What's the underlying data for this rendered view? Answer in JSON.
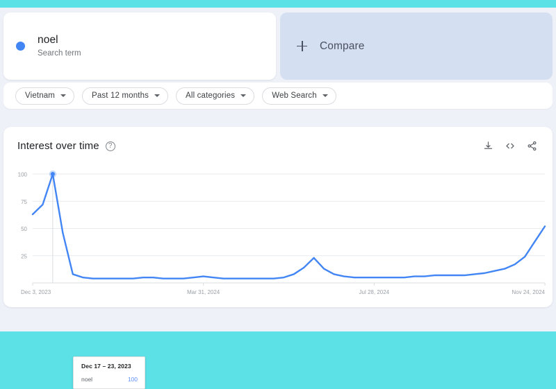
{
  "theme": {
    "page_border_color": "#5ce1e6",
    "page_background": "#eef1f8",
    "card_background": "#ffffff",
    "compare_background": "#d4dff1",
    "series_color": "#4285f4",
    "tooltip_value_color": "#5b8ff9"
  },
  "search_term_card": {
    "dot_color": "#4285f4",
    "term": "noel",
    "subtitle": "Search term"
  },
  "compare_card": {
    "icon": "plus-icon",
    "label": "Compare"
  },
  "filters": [
    {
      "label": "Vietnam",
      "icon": "chevron-down-icon"
    },
    {
      "label": "Past 12 months",
      "icon": "chevron-down-icon"
    },
    {
      "label": "All categories",
      "icon": "chevron-down-icon"
    },
    {
      "label": "Web Search",
      "icon": "chevron-down-icon"
    }
  ],
  "chart_panel": {
    "title": "Interest over time",
    "help_icon": "help-icon",
    "help_glyph": "?",
    "actions": [
      {
        "name": "download-icon",
        "title": "Download"
      },
      {
        "name": "embed-code-icon",
        "title": "Embed"
      },
      {
        "name": "share-icon",
        "title": "Share"
      }
    ]
  },
  "tooltip": {
    "date_range": "Dec 17 – 23, 2023",
    "term": "noel",
    "value": "100"
  },
  "chart_data": {
    "type": "line",
    "title": "Interest over time",
    "xlabel": "",
    "ylabel": "",
    "ylim": [
      0,
      100
    ],
    "yticks": [
      25,
      50,
      75,
      100
    ],
    "ytick_labels": [
      "25",
      "50",
      "75",
      "100"
    ],
    "grid": true,
    "legend": false,
    "xtick_labels": [
      "Dec 3, 2023",
      "Mar 31, 2024",
      "Jul 28, 2024",
      "Nov 24, 2024"
    ],
    "xtick_positions": [
      0,
      17,
      34,
      51
    ],
    "highlight_index": 2,
    "series": [
      {
        "name": "noel",
        "color": "#4285f4",
        "x": [
          "Dec 3, 2023",
          "Dec 10, 2023",
          "Dec 17, 2023",
          "Dec 24, 2023",
          "Dec 31, 2023",
          "Jan 7, 2024",
          "Jan 14, 2024",
          "Jan 21, 2024",
          "Jan 28, 2024",
          "Feb 4, 2024",
          "Feb 11, 2024",
          "Feb 18, 2024",
          "Feb 25, 2024",
          "Mar 3, 2024",
          "Mar 10, 2024",
          "Mar 17, 2024",
          "Mar 24, 2024",
          "Mar 31, 2024",
          "Apr 7, 2024",
          "Apr 14, 2024",
          "Apr 21, 2024",
          "Apr 28, 2024",
          "May 5, 2024",
          "May 12, 2024",
          "May 19, 2024",
          "May 26, 2024",
          "Jun 2, 2024",
          "Jun 9, 2024",
          "Jun 16, 2024",
          "Jun 23, 2024",
          "Jun 30, 2024",
          "Jul 7, 2024",
          "Jul 14, 2024",
          "Jul 21, 2024",
          "Jul 28, 2024",
          "Aug 4, 2024",
          "Aug 11, 2024",
          "Aug 18, 2024",
          "Aug 25, 2024",
          "Sep 1, 2024",
          "Sep 8, 2024",
          "Sep 15, 2024",
          "Sep 22, 2024",
          "Sep 29, 2024",
          "Oct 6, 2024",
          "Oct 13, 2024",
          "Oct 20, 2024",
          "Oct 27, 2024",
          "Nov 3, 2024",
          "Nov 10, 2024",
          "Nov 17, 2024",
          "Nov 24, 2024"
        ],
        "values": [
          63,
          72,
          100,
          46,
          8,
          5,
          4,
          4,
          4,
          4,
          4,
          5,
          5,
          4,
          4,
          4,
          5,
          6,
          5,
          4,
          4,
          4,
          4,
          4,
          4,
          5,
          8,
          14,
          23,
          13,
          8,
          6,
          5,
          5,
          5,
          5,
          5,
          5,
          6,
          6,
          7,
          7,
          7,
          7,
          8,
          9,
          11,
          13,
          17,
          24,
          38,
          52
        ]
      }
    ]
  }
}
